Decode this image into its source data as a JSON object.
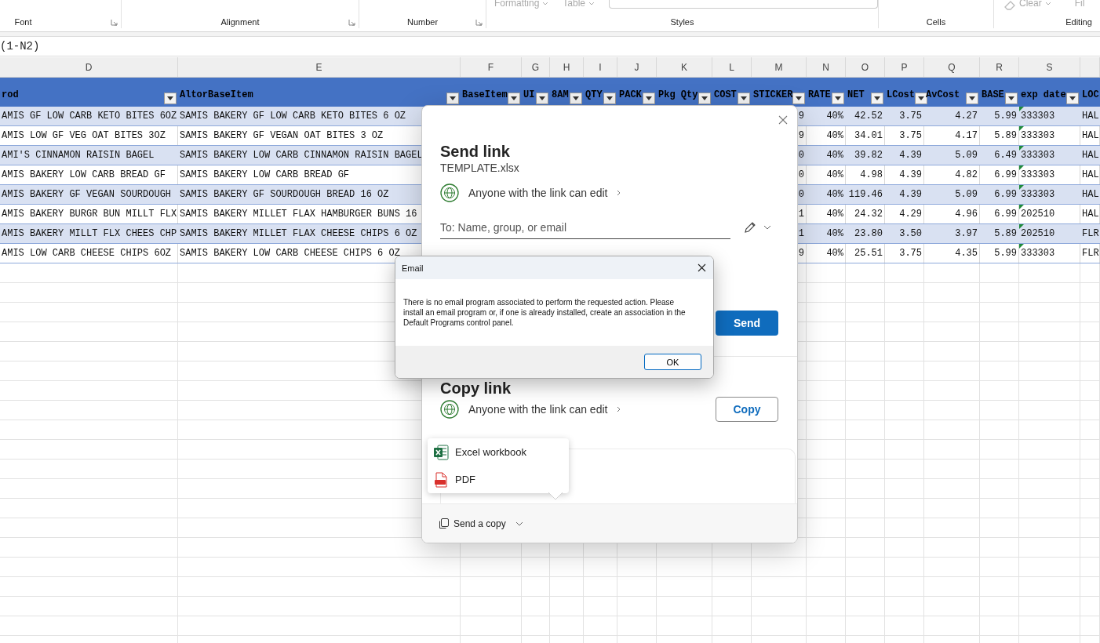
{
  "ribbon": {
    "groups": [
      {
        "label": "Font",
        "launcher": true
      },
      {
        "label": "Alignment",
        "launcher": true
      },
      {
        "label": "Number",
        "launcher": true
      },
      {
        "label": "Styles",
        "launcher": false
      },
      {
        "label": "Cells",
        "launcher": false
      },
      {
        "label": "Editing",
        "launcher": false
      }
    ],
    "styles_controls": [
      "Formatting",
      "Table"
    ],
    "editing_controls": [
      "Clear",
      "Fil"
    ]
  },
  "formula_bar": {
    "value": "(1-N2)"
  },
  "sheet": {
    "columns": [
      {
        "letter": "D",
        "header": "rod"
      },
      {
        "letter": "E",
        "header": "AltorBaseItem"
      },
      {
        "letter": "F",
        "header": "BaseItem"
      },
      {
        "letter": "G",
        "header": "UI"
      },
      {
        "letter": "H",
        "header": "8AM"
      },
      {
        "letter": "I",
        "header": "QTY"
      },
      {
        "letter": "J",
        "header": "PACK"
      },
      {
        "letter": "K",
        "header": "Pkg Qty"
      },
      {
        "letter": "L",
        "header": "COST"
      },
      {
        "letter": "M",
        "header": "STICKER"
      },
      {
        "letter": "N",
        "header": "RATE"
      },
      {
        "letter": "O",
        "header": "NET"
      },
      {
        "letter": "P",
        "header": "LCost"
      },
      {
        "letter": "Q",
        "header": "AvCost"
      },
      {
        "letter": "R",
        "header": "BASE"
      },
      {
        "letter": "S",
        "header": "exp date"
      },
      {
        "header": "LOC"
      }
    ],
    "rows": [
      {
        "prod": "AMIS GF LOW CARB KETO BITES 6OZ",
        "altor_base_item": "SAMIS BAKERY GF LOW CARB KETO BITES 6 OZ",
        "sticker": "9",
        "rate": "40%",
        "net": "42.52",
        "lcost": "3.75",
        "avcost": "4.27",
        "base": "5.99",
        "exp_date": "333303",
        "loc": "HAL",
        "flagged": true
      },
      {
        "prod": "AMIS LOW GF VEG OAT BITES 3OZ",
        "altor_base_item": "SAMIS BAKERY GF VEGAN OAT BITES 3 OZ",
        "sticker": "9",
        "rate": "40%",
        "net": "34.01",
        "lcost": "3.75",
        "avcost": "4.17",
        "base": "5.89",
        "exp_date": "333303",
        "loc": "HAL",
        "flagged": true
      },
      {
        "prod": "AMI'S CINNAMON RAISIN BAGEL",
        "altor_base_item": "SAMIS BAKERY LOW CARB CINNAMON RAISIN BAGEL",
        "sticker": "0",
        "rate": "40%",
        "net": "39.82",
        "lcost": "4.39",
        "avcost": "5.09",
        "base": "6.49",
        "exp_date": "333303",
        "loc": "HAL",
        "flagged": true
      },
      {
        "prod": "AMIS BAKERY LOW CARB BREAD GF",
        "altor_base_item": "SAMIS BAKERY LOW CARB BREAD GF",
        "sticker": "0",
        "rate": "40%",
        "net": "4.98",
        "lcost": "4.39",
        "avcost": "4.82",
        "base": "6.99",
        "exp_date": "333303",
        "loc": "HAL",
        "flagged": true
      },
      {
        "prod": "AMIS BAKERY GF VEGAN SOURDOUGH",
        "altor_base_item": "SAMIS BAKERY GF SOURDOUGH BREAD 16 OZ",
        "sticker": "0",
        "rate": "40%",
        "net": "119.46",
        "lcost": "4.39",
        "avcost": "5.09",
        "base": "6.99",
        "exp_date": "333303",
        "loc": "HAL",
        "flagged": true
      },
      {
        "prod": "AMIS BAKERY BURGR BUN MILLT FLX",
        "altor_base_item": "SAMIS BAKERY MILLET FLAX HAMBURGER BUNS 16",
        "sticker": "1",
        "rate": "40%",
        "net": "24.32",
        "lcost": "4.29",
        "avcost": "4.96",
        "base": "6.99",
        "exp_date": "202510",
        "loc": "HAL",
        "flagged": true
      },
      {
        "prod": "AMIS BAKERY MILLT FLX CHEES CHP",
        "altor_base_item": "SAMIS BAKERY MILLET FLAX CHEESE CHIPS 6 OZ",
        "sticker": "1",
        "rate": "40%",
        "net": "23.80",
        "lcost": "3.50",
        "avcost": "3.97",
        "base": "5.89",
        "exp_date": "202510",
        "loc": "FLR",
        "flagged": true
      },
      {
        "prod": "AMIS LOW CARB CHEESE CHIPS 6OZ",
        "altor_base_item": "SAMIS BAKERY LOW CARB CHEESE CHIPS 6 OZ",
        "sticker": "9",
        "rate": "40%",
        "net": "25.51",
        "lcost": "3.75",
        "avcost": "4.35",
        "base": "5.99",
        "exp_date": "333303",
        "loc": "FLR",
        "flagged": true
      }
    ]
  },
  "share_dialog": {
    "title": "Send link",
    "file_name": "TEMPLATE.xlsx",
    "permission": "Anyone with the link can edit",
    "to_placeholder": "To: Name, group, or email",
    "send_button": "Send",
    "copy_title": "Copy link",
    "copy_permission": "Anyone with the link can edit",
    "copy_button": "Copy",
    "send_copy_button": "Send a copy",
    "send_copy_menu": [
      {
        "kind": "excel",
        "label": "Excel workbook"
      },
      {
        "kind": "pdf",
        "label": "PDF"
      }
    ]
  },
  "email_dialog": {
    "title": "Email",
    "message": "There is no email program associated to perform the requested action. Please install an email program or, if one is already installed, create an association in the Default Programs control panel.",
    "ok_button": "OK"
  }
}
